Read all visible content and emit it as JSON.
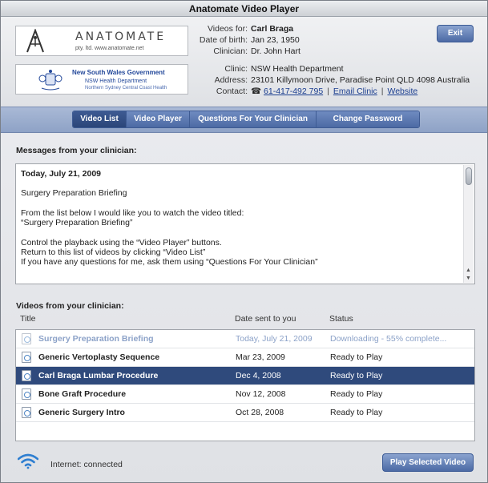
{
  "window": {
    "title": "Anatomate Video Player"
  },
  "logos": {
    "anatomate": {
      "name": "ANATOMATE",
      "tagline": "pty. ltd.  www.anatomate.net"
    },
    "nsw": {
      "line1": "New South Wales Government",
      "line2": "NSW Health Department",
      "line3": "Northern Sydney Central Coast Health"
    }
  },
  "patient": {
    "videos_for_label": "Videos for:",
    "videos_for": "Carl Braga",
    "dob_label": "Date of birth:",
    "dob": "Jan 23, 1950",
    "clinician_label": "Clinician:",
    "clinician": "Dr. John Hart",
    "clinic_label": "Clinic:",
    "clinic": "NSW Health Department",
    "address_label": "Address:",
    "address": "23101 Killymoon Drive, Paradise Point QLD 4098 Australia",
    "contact_label": "Contact:",
    "phone_icon": "☎",
    "phone": "61-417-492 795",
    "sep": "|",
    "email": "Email Clinic",
    "website": "Website"
  },
  "buttons": {
    "exit": "Exit",
    "play_selected": "Play Selected Video"
  },
  "tabs": [
    {
      "label": "Video List",
      "active": true
    },
    {
      "label": "Video Player",
      "active": false
    },
    {
      "label": "Questions For Your Clinician",
      "active": false
    },
    {
      "label": "Change Password",
      "active": false
    }
  ],
  "messages": {
    "heading": "Messages from your clinician:",
    "date": "Today, July 21, 2009",
    "lines": [
      "Surgery Preparation Briefing",
      "From the list below I would like you to watch the video titled:",
      "“Surgery Preparation Briefing”",
      "Control the playback using the “Video Player” buttons.",
      "Return to this list of videos by clicking “Video List”",
      "If you have any questions for me, ask them using “Questions For Your Clinician”"
    ]
  },
  "videos": {
    "heading": "Videos from your clinician:",
    "columns": [
      "Title",
      "Date sent to you",
      "Status"
    ],
    "rows": [
      {
        "title": "Surgery Preparation Briefing",
        "date": "Today, July 21, 2009",
        "status": "Downloading - 55% complete...",
        "state": "downloading",
        "progress_percent": 55
      },
      {
        "title": "Generic Vertoplasty Sequence",
        "date": "Mar 23, 2009",
        "status": "Ready to Play",
        "state": "ready"
      },
      {
        "title": "Carl Braga Lumbar Procedure",
        "date": "Dec 4, 2008",
        "status": "Ready to Play",
        "state": "selected"
      },
      {
        "title": "Bone Graft Procedure",
        "date": "Nov 12, 2008",
        "status": "Ready to Play",
        "state": "ready"
      },
      {
        "title": "Generic Surgery Intro",
        "date": "Oct 28, 2008",
        "status": "Ready to Play",
        "state": "ready"
      }
    ]
  },
  "status": {
    "internet": "Internet: connected",
    "wifi_icon": "wifi-icon"
  },
  "colors": {
    "accent": "#4c6aa5",
    "selected_row": "#2f4a7c",
    "downloading_text": "#8ca2c8"
  }
}
